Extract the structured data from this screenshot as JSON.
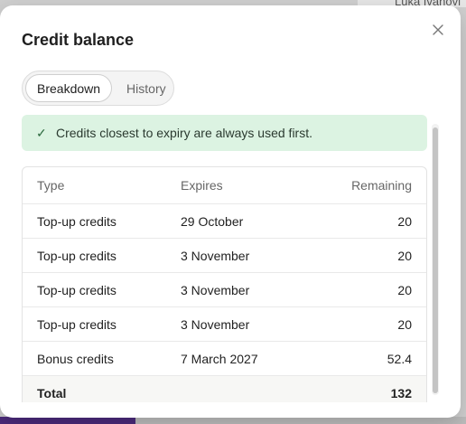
{
  "background": {
    "user_name": "Luka Ivanovi"
  },
  "modal": {
    "title": "Credit balance",
    "close_icon": "close-icon"
  },
  "tabs": [
    {
      "label": "Breakdown",
      "active": true
    },
    {
      "label": "History",
      "active": false
    }
  ],
  "notice": {
    "icon": "check-icon",
    "text": "Credits closest to expiry are always used first.",
    "bg_color": "#dcf3e2"
  },
  "table": {
    "headers": {
      "type": "Type",
      "expires": "Expires",
      "remaining": "Remaining"
    },
    "rows": [
      {
        "type": "Top-up credits",
        "expires": "29 October",
        "remaining": "20"
      },
      {
        "type": "Top-up credits",
        "expires": "3 November",
        "remaining": "20"
      },
      {
        "type": "Top-up credits",
        "expires": "3 November",
        "remaining": "20"
      },
      {
        "type": "Top-up credits",
        "expires": "3 November",
        "remaining": "20"
      },
      {
        "type": "Bonus credits",
        "expires": "7 March 2027",
        "remaining": "52.4"
      }
    ],
    "total": {
      "label": "Total",
      "value": "132"
    }
  }
}
